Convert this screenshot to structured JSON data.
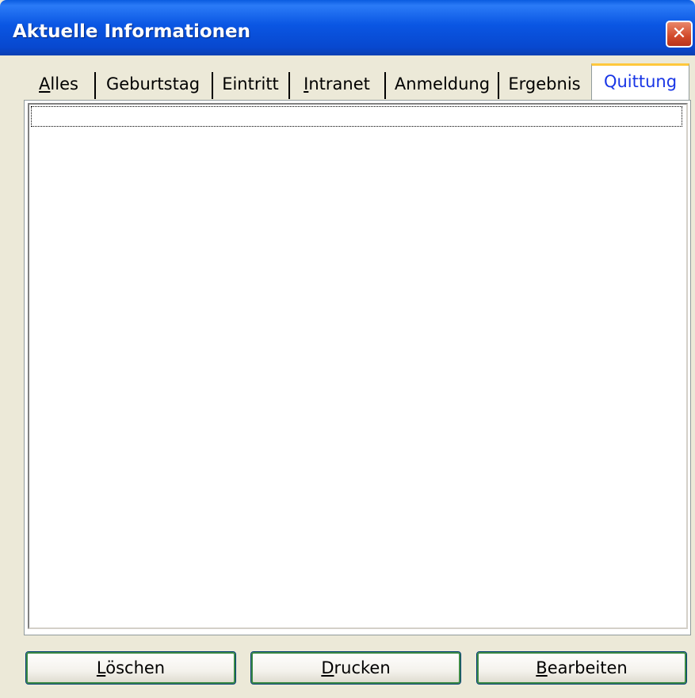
{
  "window": {
    "title": "Aktuelle Informationen",
    "close_icon": "close-icon"
  },
  "tabs": [
    {
      "label": "Alles",
      "mnemonic_index": 0
    },
    {
      "label": "Geburtstag",
      "mnemonic_index": null
    },
    {
      "label": "Eintritt",
      "mnemonic_index": null
    },
    {
      "label": "Intranet",
      "mnemonic_index": 0
    },
    {
      "label": "Anmeldung",
      "mnemonic_index": null
    },
    {
      "label": "Ergebnis",
      "mnemonic_index": null
    },
    {
      "label": "Quittung",
      "mnemonic_index": null,
      "selected": true
    }
  ],
  "list": {
    "items": [
      ""
    ]
  },
  "buttons": {
    "delete": "Löschen",
    "print": "Drucken",
    "edit": "Bearbeiten"
  },
  "colors": {
    "titlebar": "#0A56E3",
    "dialog_bg": "#ECE9D8",
    "active_tab_text": "#1936E6",
    "active_tab_highlight": "#FFC83C",
    "close_button": "#D24A2A"
  }
}
